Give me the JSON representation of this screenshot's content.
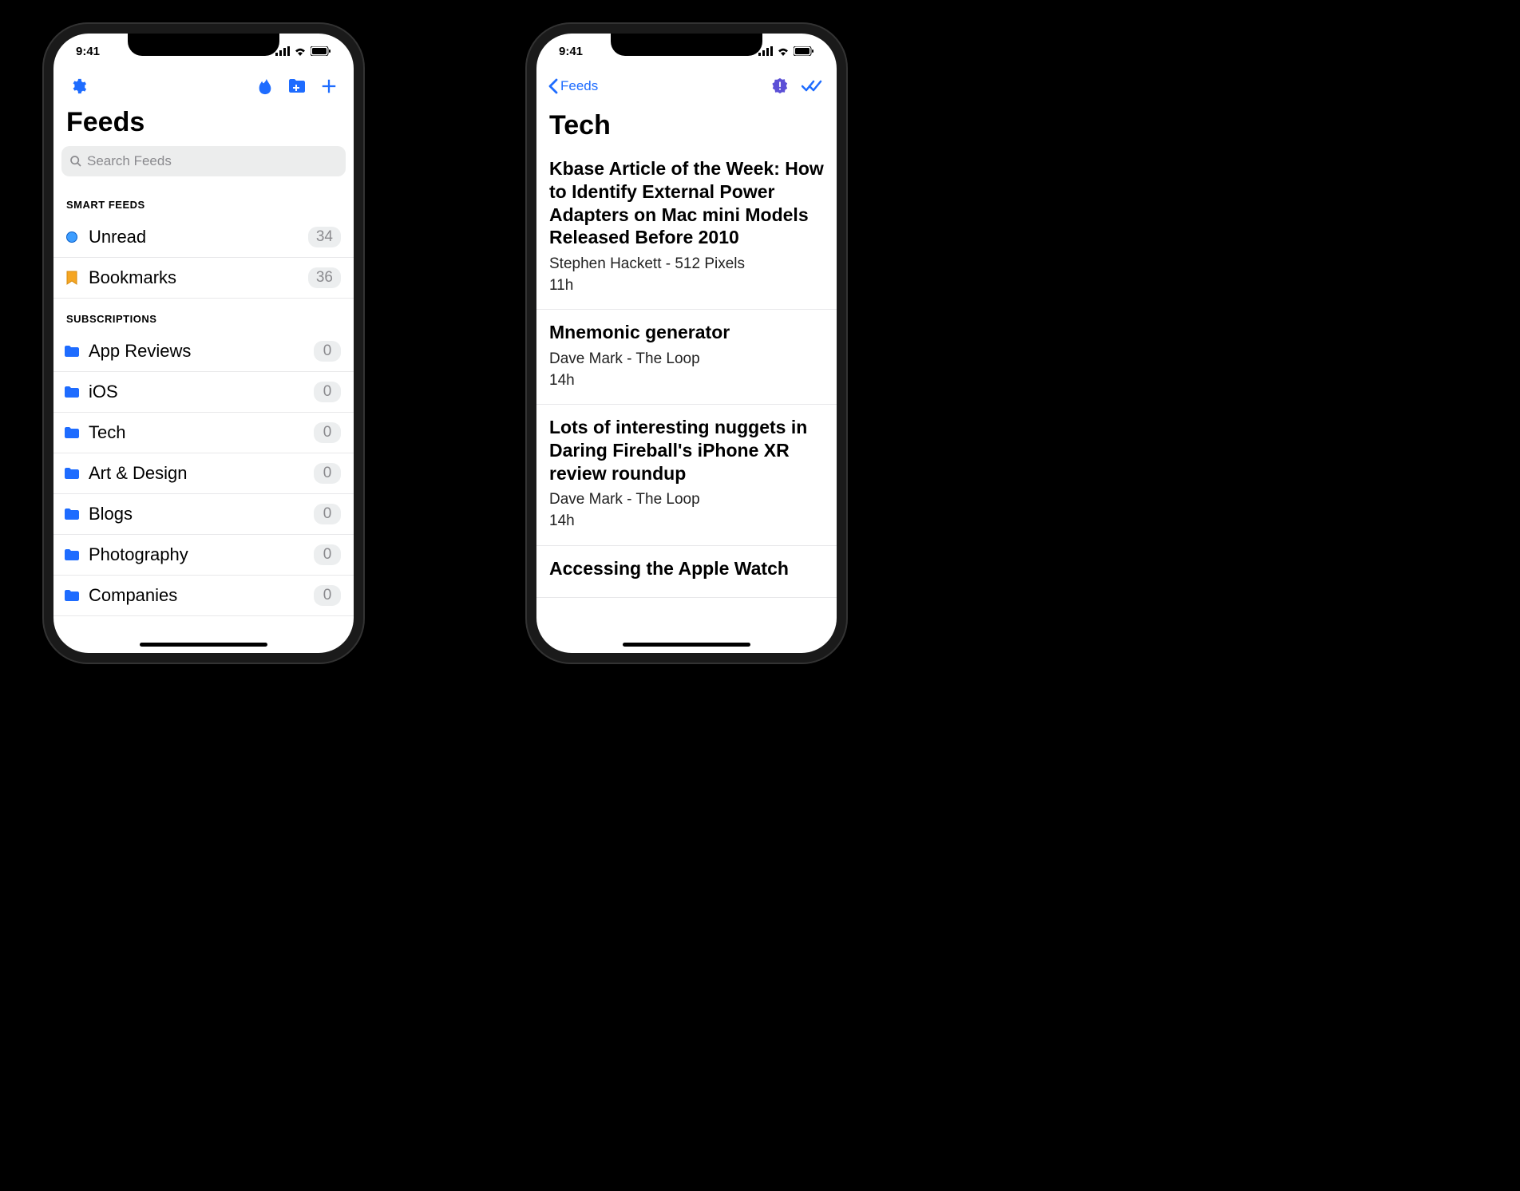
{
  "status": {
    "time": "9:41"
  },
  "feeds": {
    "title": "Feeds",
    "search_placeholder": "Search Feeds",
    "sections": {
      "smart": {
        "header": "SMART FEEDS",
        "items": [
          {
            "icon": "unread-dot",
            "label": "Unread",
            "count": "34"
          },
          {
            "icon": "bookmark",
            "label": "Bookmarks",
            "count": "36"
          }
        ]
      },
      "subs": {
        "header": "SUBSCRIPTIONS",
        "items": [
          {
            "icon": "folder",
            "label": "App Reviews",
            "count": "0"
          },
          {
            "icon": "folder",
            "label": "iOS",
            "count": "0"
          },
          {
            "icon": "folder",
            "label": "Tech",
            "count": "0"
          },
          {
            "icon": "folder",
            "label": "Art & Design",
            "count": "0"
          },
          {
            "icon": "folder",
            "label": "Blogs",
            "count": "0"
          },
          {
            "icon": "folder",
            "label": "Photography",
            "count": "0"
          },
          {
            "icon": "folder",
            "label": "Companies",
            "count": "0"
          }
        ]
      }
    }
  },
  "detail": {
    "back_label": "Feeds",
    "title": "Tech",
    "articles": [
      {
        "title": "Kbase Article of the Week: How to Identify External Power Adapters on Mac mini Models Released Before 2010",
        "meta": "Stephen Hackett - 512 Pixels",
        "time": "11h"
      },
      {
        "title": "Mnemonic generator",
        "meta": "Dave Mark - The Loop",
        "time": "14h"
      },
      {
        "title": "Lots of interesting nuggets in Daring Fireball's iPhone XR review roundup",
        "meta": "Dave Mark - The Loop",
        "time": "14h"
      },
      {
        "title": "Accessing the Apple Watch",
        "meta": "",
        "time": ""
      }
    ]
  }
}
